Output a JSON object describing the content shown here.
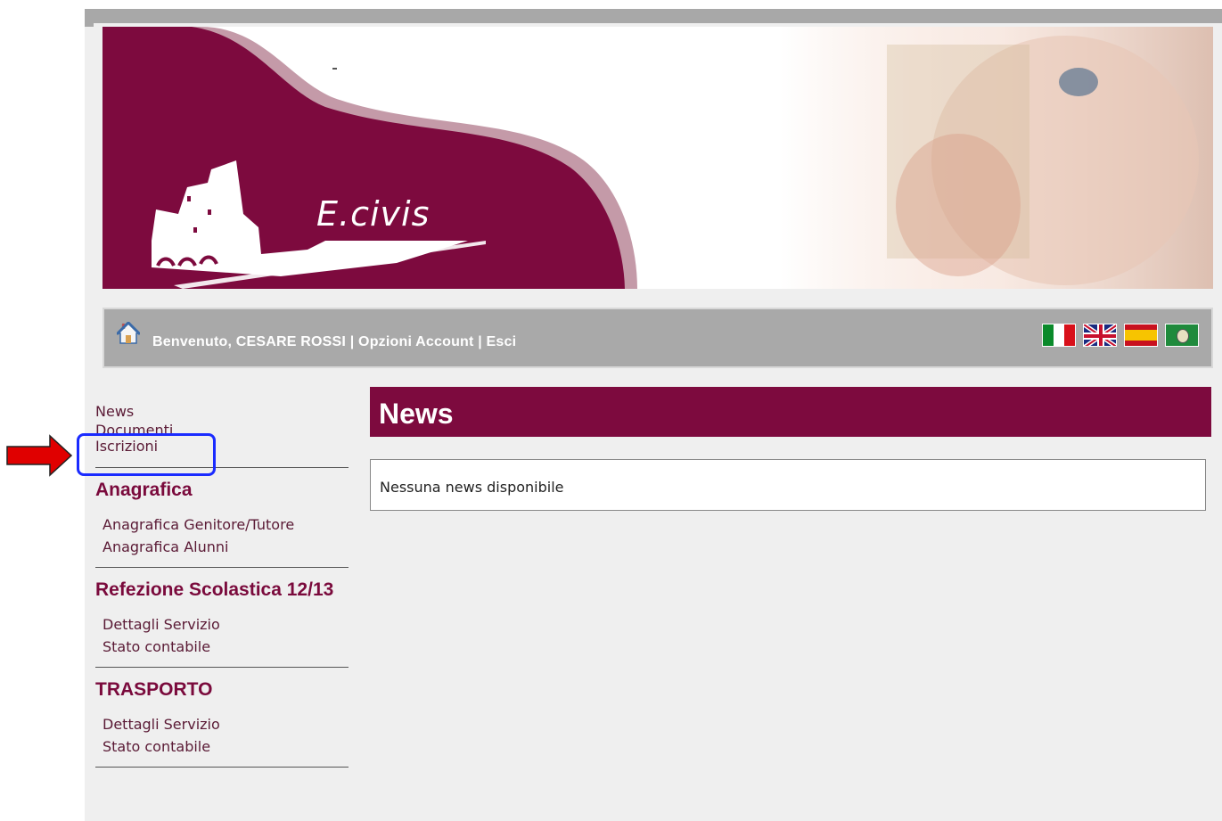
{
  "banner": {
    "logo_text": "E.civis",
    "dash": "-"
  },
  "userbar": {
    "welcome": "Benvenuto, CESARE ROSSI",
    "separator1": " | ",
    "account_options": "Opzioni Account",
    "separator2": "   | ",
    "logout": "Esci"
  },
  "flags": [
    "italian-flag",
    "uk-flag",
    "spanish-flag",
    "regional-flag"
  ],
  "sidebar": {
    "top_links": [
      "News",
      "Documenti",
      "Iscrizioni"
    ],
    "sections": [
      {
        "heading": "Anagrafica",
        "items": [
          "Anagrafica Genitore/Tutore",
          "Anagrafica Alunni"
        ]
      },
      {
        "heading": "Refezione Scolastica 12/13",
        "items": [
          "Dettagli Servizio",
          "Stato contabile"
        ]
      },
      {
        "heading": "TRASPORTO",
        "items": [
          "Dettagli Servizio",
          "Stato contabile"
        ]
      }
    ]
  },
  "main": {
    "title": "News",
    "empty_message": "Nessuna news disponibile"
  },
  "colors": {
    "brand": "#7d0a3e",
    "bar": "#a9a9a9",
    "highlight": "#1a2bff",
    "arrow": "#e00000"
  }
}
